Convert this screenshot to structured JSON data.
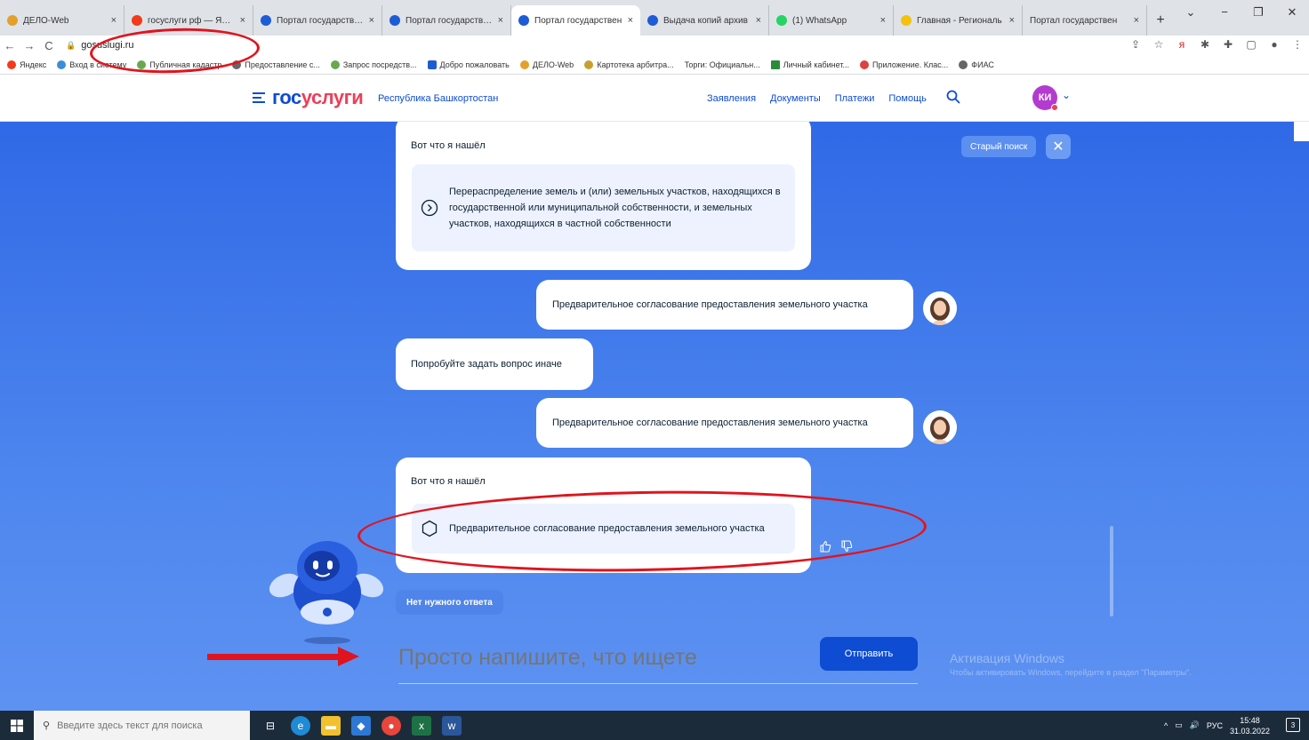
{
  "browser": {
    "tabs": [
      {
        "title": "ДЕЛО-Web",
        "color": "#e5a02a"
      },
      {
        "title": "госуслуги рф — Янде",
        "color": "#f33a1a"
      },
      {
        "title": "Портал государствен",
        "color": "#1e5bd6"
      },
      {
        "title": "Портал государствен",
        "color": "#1e5bd6"
      },
      {
        "title": "Портал государствен",
        "color": "#1e5bd6",
        "active": true
      },
      {
        "title": "Выдача копий архив",
        "color": "#1e5bd6"
      },
      {
        "title": "(1) WhatsApp",
        "color": "#25d366"
      },
      {
        "title": "Главная - Региональ",
        "color": "#f4c20d"
      },
      {
        "title": "Портал государствен",
        "color": "#1e5bd6"
      }
    ],
    "url": "gosuslugi.ru",
    "bookmarks": [
      {
        "label": "Яндекс",
        "color": "#f33a1a"
      },
      {
        "label": "Вход в систему",
        "color": "#3c8dd8"
      },
      {
        "label": "Публичная кадастр",
        "color": "#6aa84f"
      },
      {
        "label": "Предоставление с...",
        "color": "#666"
      },
      {
        "label": "Запрос посредств...",
        "color": "#6aa84f"
      },
      {
        "label": "Добро пожаловать",
        "color": "#1e5bd6"
      },
      {
        "label": "ДЕЛО-Web",
        "color": "#e5a02a"
      },
      {
        "label": "Картотека арбитра...",
        "color": "#c8a030"
      },
      {
        "label": "Торги: Официальн...",
        "color": "#ffffff"
      },
      {
        "label": "Личный кабинет...",
        "color": "#2a8c3a"
      },
      {
        "label": "Приложение. Клас...",
        "color": "#e04040"
      },
      {
        "label": "ФИАС",
        "color": "#666"
      }
    ]
  },
  "site": {
    "logo_part1": "гос",
    "logo_part2": "услуги",
    "region": "Республика Башкортостан",
    "nav": [
      "Заявления",
      "Документы",
      "Платежи",
      "Помощь"
    ],
    "avatar_initials": "КИ",
    "brand_color": "#0d4cd3",
    "accent_color": "#ee3f58"
  },
  "chat": {
    "old_search_label": "Старый поиск",
    "messages": [
      {
        "from": "bot",
        "heading": "Вот что я нашёл",
        "result": "Перераспределение земель и (или) земельных участков, находящихся в государственной или муниципальной собственности, и земельных участков, находящихся в частной собственности",
        "icon": "chevron-circle-icon"
      },
      {
        "from": "user",
        "text": "Предварительное согласование предоставления земельного участка"
      },
      {
        "from": "bot",
        "text": "Попробуйте задать вопрос иначе"
      },
      {
        "from": "user",
        "text": "Предварительное согласование предоставления земельного участка"
      },
      {
        "from": "bot",
        "heading": "Вот что я нашёл",
        "result": "Предварительное согласование предоставления земельного участка",
        "icon": "hexagon-icon"
      }
    ],
    "no_answer_label": "Нет нужного ответа",
    "input_placeholder": "Просто напишите, что ищете",
    "send_label": "Отправить"
  },
  "watermark": {
    "title": "Активация Windows",
    "subtitle": "Чтобы активировать Windows, перейдите в раздел \"Параметры\"."
  },
  "taskbar": {
    "search_placeholder": "Введите здесь текст для поиска",
    "language": "РУС",
    "time": "15:48",
    "date": "31.03.2022",
    "notifications": "3"
  }
}
